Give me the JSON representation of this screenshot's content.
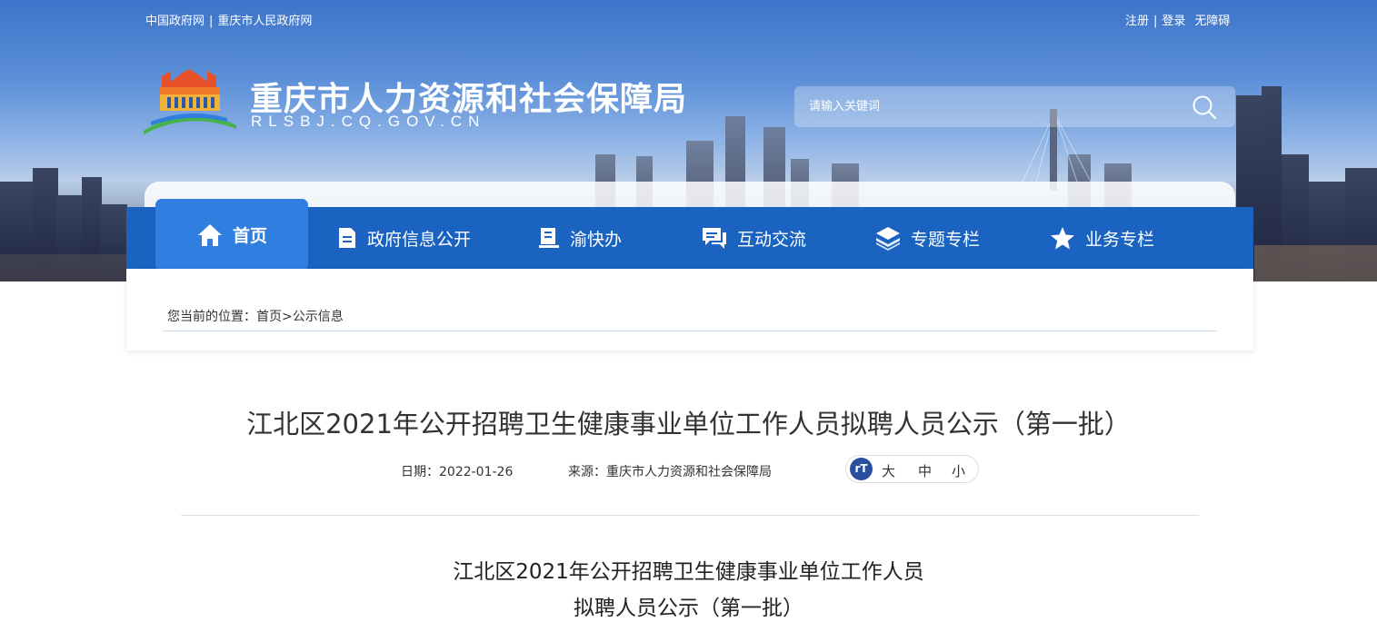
{
  "header": {
    "top_links_left": [
      "中国政府网",
      "重庆市人民政府网"
    ],
    "top_links_right": {
      "register": "注册",
      "login": "登录",
      "accessibility": "无障碍"
    },
    "site_title": "重庆市人力资源和社会保障局",
    "site_domain": "RLSBJ.CQ.GOV.CN",
    "search": {
      "placeholder": "请输入关键词"
    }
  },
  "nav": {
    "items": [
      {
        "label": "首页",
        "icon": "home-icon",
        "active": true
      },
      {
        "label": "政府信息公开",
        "icon": "document-icon"
      },
      {
        "label": "渝快办",
        "icon": "book-icon"
      },
      {
        "label": "互动交流",
        "icon": "chat-icon"
      },
      {
        "label": "专题专栏",
        "icon": "layers-icon"
      },
      {
        "label": "业务专栏",
        "icon": "star-icon"
      }
    ]
  },
  "breadcrumb": {
    "prefix": "您当前的位置：",
    "home": "首页",
    "sep": ">",
    "current": "公示信息"
  },
  "article": {
    "title": "江北区2021年公开招聘卫生健康事业单位工作人员拟聘人员公示（第一批）",
    "date": "日期：2022-01-26",
    "source": "来源：重庆市人力资源和社会保障局",
    "font_sizes": {
      "large": "大",
      "medium": "中",
      "small": "小"
    },
    "font_icon_text": "rT",
    "body_heading_lines": [
      "江北区2021年公开招聘卫生健康事业单位工作人员",
      "拟聘人员公示（第一批）"
    ]
  },
  "colors": {
    "nav_bar": "#1a63c1",
    "nav_active": "#2f7ee0",
    "font_icon": "#2a4f9c"
  }
}
